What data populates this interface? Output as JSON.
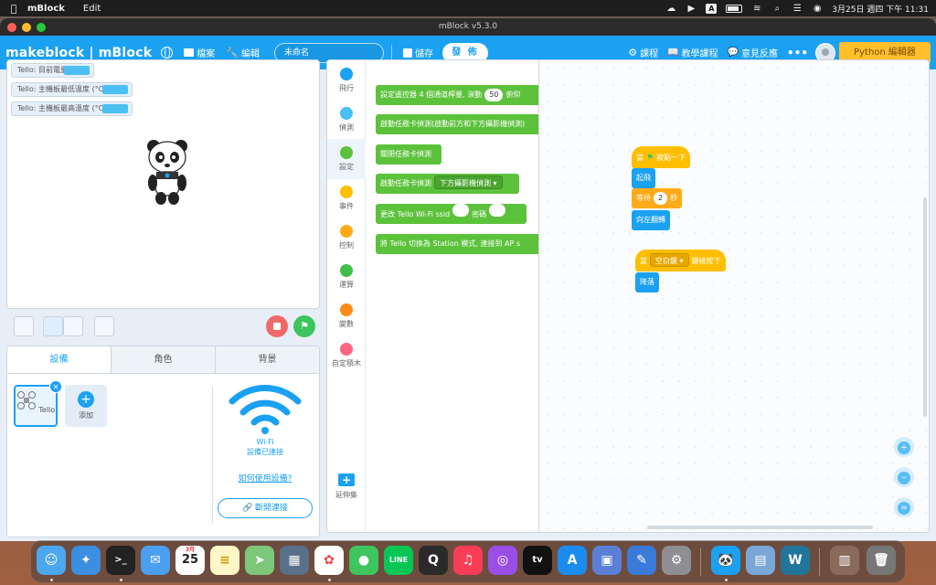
{
  "menubar": {
    "app_name": "mBlock",
    "menu_edit": "Edit",
    "datetime": "3月25日 週四 下午 11:31",
    "input_source": "A"
  },
  "window": {
    "title": "mBlock v5.3.0"
  },
  "toolbar": {
    "logo": "makeblock | mBlock",
    "file_label": "檔案",
    "edit_label": "編輯",
    "project_name": "未命名",
    "save_label": "儲存",
    "publish_label": "發 佈",
    "courses_label": "課程",
    "tutorials_label": "教學課程",
    "feedback_label": "意見反應",
    "more_label": "•••",
    "python_label": "Python 編輯器"
  },
  "stage": {
    "monitors": [
      {
        "label": "Tello: 目前電量"
      },
      {
        "label": "Tello: 主機板最低溫度 (°C)"
      },
      {
        "label": "Tello: 主機板最高溫度 (°C)"
      }
    ]
  },
  "device_panel": {
    "tabs": [
      {
        "label": "設備",
        "active": true
      },
      {
        "label": "角色",
        "active": false
      },
      {
        "label": "背景",
        "active": false
      }
    ],
    "device_name": "Tello",
    "remove_label": "×",
    "add_label": "添加",
    "wifi_line1": "Wi-Fi",
    "wifi_line2": "設備已連接",
    "how_link": "如何使用設備?",
    "disconnect_label": "斷開連接"
  },
  "palette": {
    "categories": [
      {
        "label": "飛行",
        "color": "#1ba1f2"
      },
      {
        "label": "偵測",
        "color": "#4cbff3"
      },
      {
        "label": "設定",
        "color": "#5cc23b",
        "active": true
      },
      {
        "label": "事件",
        "color": "#ffbf00"
      },
      {
        "label": "控制",
        "color": "#ffab19"
      },
      {
        "label": "運算",
        "color": "#40bf4a"
      },
      {
        "label": "變數",
        "color": "#ff8c1a"
      },
      {
        "label": "自定積木",
        "color": "#ff6680"
      }
    ],
    "extension_label": "延伸集",
    "blocks": [
      {
        "pre": "設定遙控器 4 個通道桿量, 滾動",
        "slot": "50",
        "post": "俯仰"
      },
      {
        "pre": "啟動任務卡偵測(啟動前方和下方攝影機偵測)"
      },
      {
        "pre": "關閉任務卡偵測"
      },
      {
        "pre": "啟動任務卡偵測",
        "drop": "下方攝影機偵測 ▾"
      },
      {
        "pre": "更改 Tello Wi-Fi ssid",
        "post": "密碼"
      },
      {
        "pre": "將 Tello 切換為 Station 模式, 連接到 AP s"
      }
    ]
  },
  "code": {
    "script1": {
      "hat_pre": "當",
      "hat_post": "被點一下",
      "takeoff": "起飛",
      "wait_pre": "等待",
      "wait_value": "2",
      "wait_post": "秒",
      "flip": "向左翻轉"
    },
    "script2": {
      "hat_pre": "當",
      "key": "空白鍵 ▾",
      "hat_post": "鍵被按下",
      "land": "降落"
    },
    "zoom_in": "+",
    "zoom_out": "−",
    "zoom_reset": "="
  },
  "dock": {
    "calendar_month": "3月",
    "calendar_day": "25"
  },
  "colors": {
    "accent": "#1ba1f2",
    "python_button": "#ffbf2b",
    "motion": "#1ba1f2",
    "event": "#ffbf00",
    "control": "#ffab19",
    "settings": "#5cc23b"
  }
}
